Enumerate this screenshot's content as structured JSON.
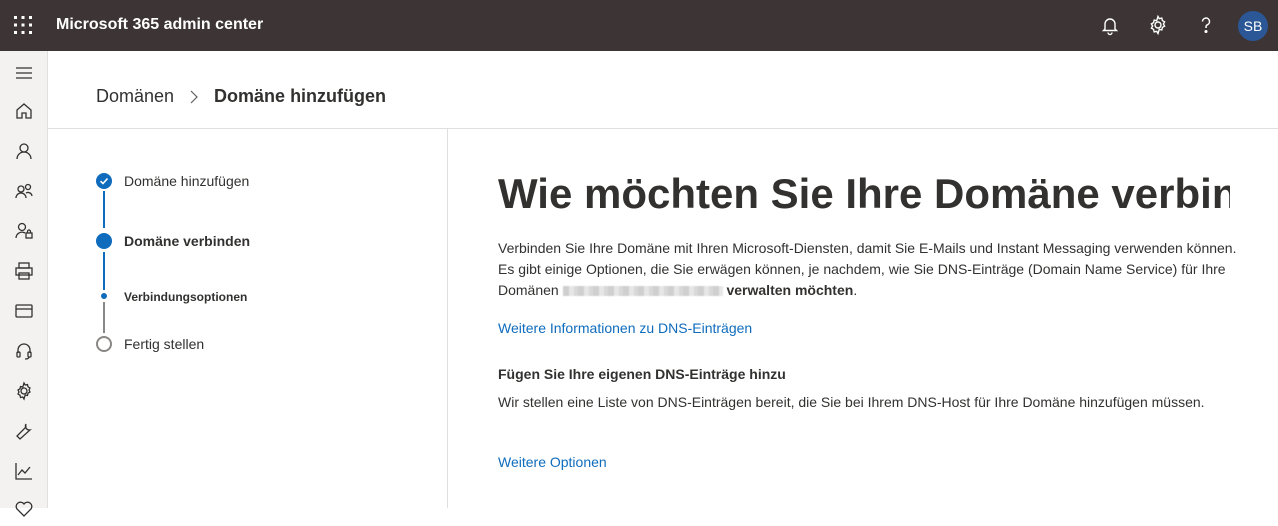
{
  "app": {
    "title": "Microsoft 365 admin center"
  },
  "user": {
    "initials": "SB"
  },
  "breadcrumb": {
    "parent": "Domänen",
    "current": "Domäne hinzufügen"
  },
  "steps": [
    {
      "label": "Domäne hinzufügen",
      "state": "completed"
    },
    {
      "label": "Domäne verbinden",
      "state": "current"
    },
    {
      "label": "Verbindungsoptionen",
      "state": "current-sub"
    },
    {
      "label": "Fertig stellen",
      "state": "pending"
    }
  ],
  "content": {
    "heading": "Wie möchten Sie Ihre Domäne verbin",
    "intro_part1": "Verbinden Sie Ihre Domäne mit Ihren Microsoft-Diensten, damit Sie E-Mails und Instant Messaging verwenden können. Es gibt einige Optionen, die Sie erwägen können, je nachdem, wie Sie DNS-Einträge (Domain Name Service) für Ihre Domänen ",
    "intro_bold": "verwalten möchten",
    "intro_end": ".",
    "dns_link": "Weitere Informationen zu DNS-Einträgen",
    "option_heading": "Fügen Sie Ihre eigenen DNS-Einträge hinzu",
    "option_text": "Wir stellen eine Liste von DNS-Einträgen bereit, die Sie bei Ihrem DNS-Host für Ihre Domäne hinzufügen müssen.",
    "more_options_link": "Weitere Optionen"
  },
  "colors": {
    "topbar": "#3c3435",
    "accent": "#0f6cbd",
    "avatar": "#2b5797"
  }
}
